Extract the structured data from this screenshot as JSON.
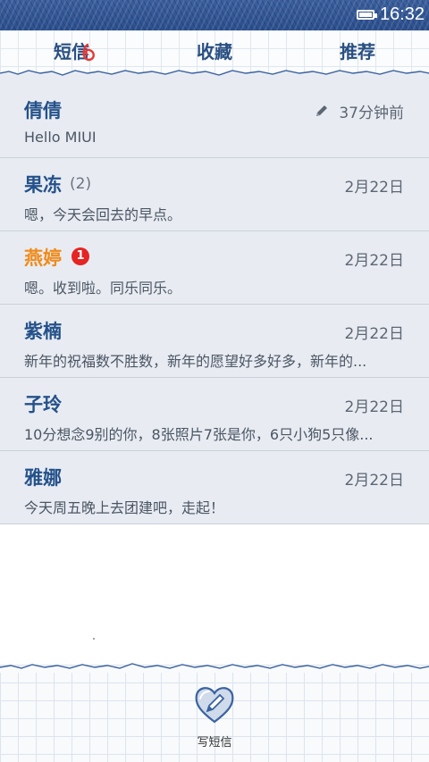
{
  "status_bar": {
    "time": "16:32",
    "battery_icon": "battery-icon"
  },
  "tabs": [
    {
      "label": "短信",
      "active": true
    },
    {
      "label": "收藏",
      "active": false
    },
    {
      "label": "推荐",
      "active": false
    }
  ],
  "conversations": [
    {
      "name": "倩倩",
      "count": "",
      "unread_badge": "",
      "date": "37分钟前",
      "draft": true,
      "preview": "Hello MIUI"
    },
    {
      "name": "果冻",
      "count": "(2)",
      "unread_badge": "",
      "date": "2月22日",
      "draft": false,
      "preview": "嗯，今天会回去的早点。"
    },
    {
      "name": "燕婷",
      "count": "",
      "unread_badge": "1",
      "date": "2月22日",
      "draft": false,
      "preview": "嗯。收到啦。同乐同乐。"
    },
    {
      "name": "紫楠",
      "count": "",
      "unread_badge": "",
      "date": "2月22日",
      "draft": false,
      "preview": "新年的祝福数不胜数，新年的愿望好多好多，新年的..."
    },
    {
      "name": "子玲",
      "count": "",
      "unread_badge": "",
      "date": "2月22日",
      "draft": false,
      "preview": "10分想念9别的你，8张照片7张是你，6只小狗5只像..."
    },
    {
      "name": "雅娜",
      "count": "",
      "unread_badge": "",
      "date": "2月22日",
      "draft": false,
      "preview": "今天周五晚上去团建吧，走起！"
    }
  ],
  "compose": {
    "label": "写短信",
    "icon": "heart-pencil-icon"
  },
  "colors": {
    "accent": "#24518a",
    "unread_name": "#f08a1a",
    "badge": "#e52424",
    "status_bar": "#2b4f8c"
  }
}
